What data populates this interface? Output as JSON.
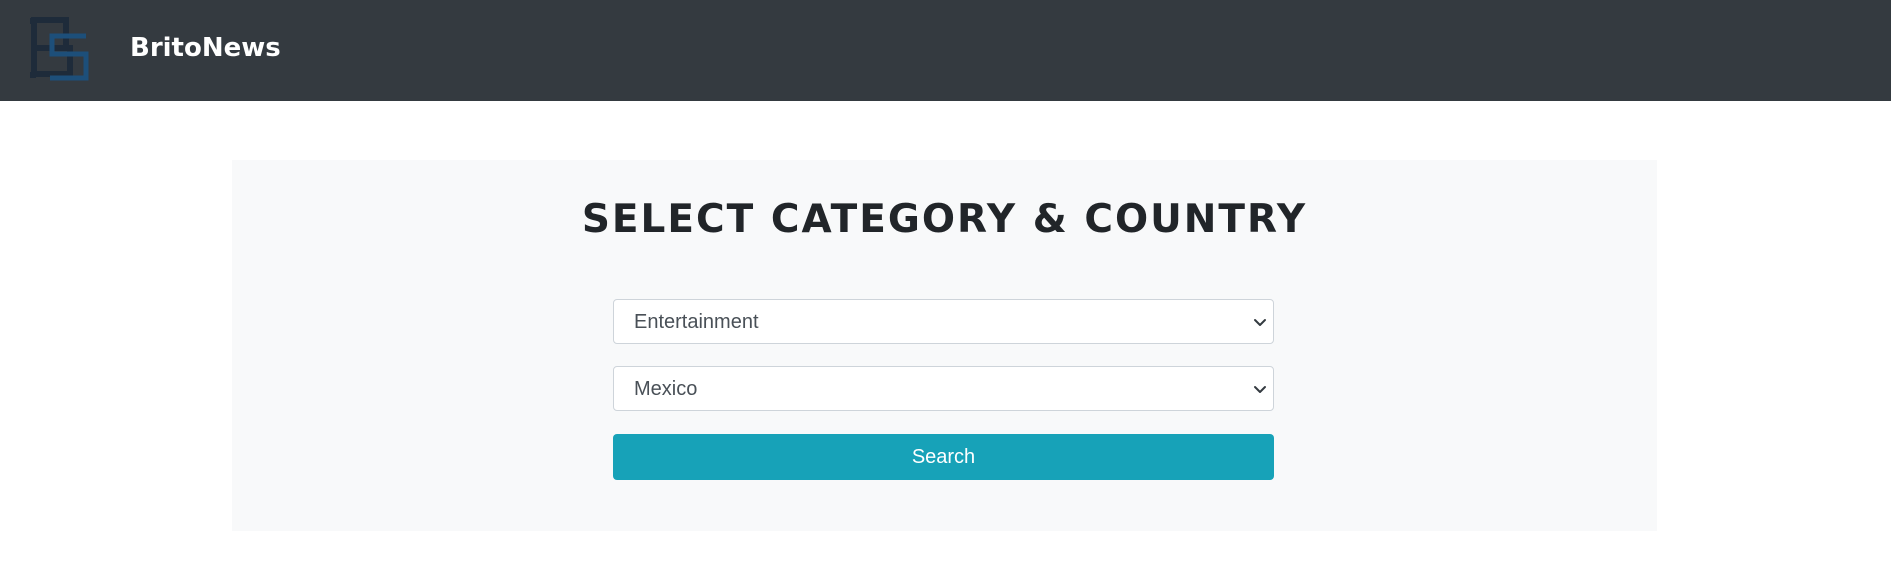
{
  "navbar": {
    "brand_name": "BritoNews",
    "logo_icon": "brand-logo-icon",
    "background_color": "#343a40"
  },
  "form": {
    "title": "SELECT CATEGORY & COUNTRY",
    "category_value": "Entertainment",
    "country_value": "Mexico",
    "search_label": "Search",
    "button_color": "#17a2b8",
    "panel_color": "#f8f9fa"
  }
}
